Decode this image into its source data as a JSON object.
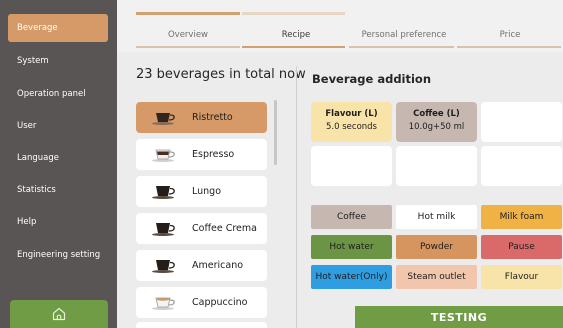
{
  "sidebar": {
    "items": [
      {
        "label": "Beverage",
        "active": true
      },
      {
        "label": "System"
      },
      {
        "label": "Operation panel"
      },
      {
        "label": "User"
      },
      {
        "label": "Language"
      },
      {
        "label": "Statistics"
      },
      {
        "label": "Help"
      },
      {
        "label": "Engineering setting"
      }
    ],
    "home_icon": "home-icon"
  },
  "tabs": [
    {
      "label": "Overview"
    },
    {
      "label": "Recipe",
      "active": true
    },
    {
      "label": "Personal preference"
    },
    {
      "label": "Price"
    }
  ],
  "beverages": {
    "count_text": "23 beverages in total now",
    "items": [
      {
        "label": "Ristretto",
        "active": true
      },
      {
        "label": "Espresso"
      },
      {
        "label": "Lungo"
      },
      {
        "label": "Coffee Crema"
      },
      {
        "label": "Americano"
      },
      {
        "label": "Cappuccino"
      }
    ]
  },
  "addition": {
    "title": "Beverage addition",
    "slots": [
      {
        "title": "Flavour (L)",
        "value": "5.0 seconds",
        "color": "#f8e3a8"
      },
      {
        "title": "Coffee (L)",
        "value": "10.0g+50 ml",
        "color": "#c6b8b0"
      }
    ]
  },
  "actions": [
    {
      "label": "Coffee",
      "color": "#c6b8b0"
    },
    {
      "label": "Hot milk",
      "color": "#ffffff"
    },
    {
      "label": "Milk foam",
      "color": "#f0b245"
    },
    {
      "label": "Hot water",
      "color": "#6b9544"
    },
    {
      "label": "Powder",
      "color": "#d6955e"
    },
    {
      "label": "Pause",
      "color": "#da6a6a"
    },
    {
      "label": "Hot water(Only)",
      "color": "#2f9ee0"
    },
    {
      "label": "Steam outlet",
      "color": "#f2c6ac"
    },
    {
      "label": "Flavour",
      "color": "#f8e3a8"
    }
  ],
  "footer": {
    "testing_label": "TESTING"
  },
  "colors": {
    "accent": "#d59a68",
    "sidebar": "#595554",
    "green": "#6f9c45"
  }
}
